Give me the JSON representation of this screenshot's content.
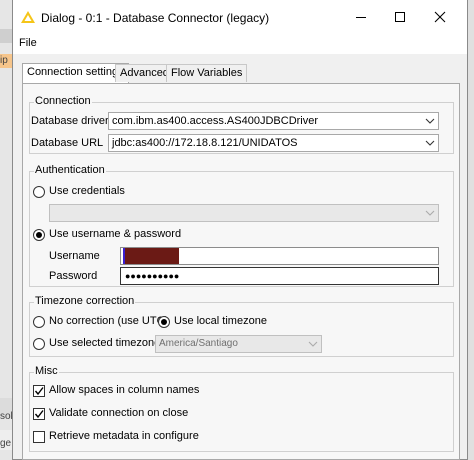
{
  "window": {
    "title": "Dialog - 0:1 - Database Connector (legacy)"
  },
  "menu": {
    "file": "File"
  },
  "tabs": [
    "Connection settings",
    "Advanced",
    "Flow Variables"
  ],
  "connection": {
    "title": "Connection",
    "driver_label": "Database driver",
    "driver_value": "com.ibm.as400.access.AS400JDBCDriver",
    "url_label": "Database URL",
    "url_value": "jdbc:as400://172.18.8.121/UNIDATOS"
  },
  "authentication": {
    "title": "Authentication",
    "use_credentials": "Use credentials",
    "credentials_value": "",
    "use_username_password": "Use username & password",
    "selected": "use_username_password",
    "username_label": "Username",
    "username_value": "",
    "password_label": "Password",
    "password_value": "●●●●●●●●●●"
  },
  "timezone": {
    "title": "Timezone correction",
    "no_correction": "No correction (use UTC)",
    "use_local": "Use local timezone",
    "use_selected": "Use selected timezone",
    "selected_timezone": "America/Santiago",
    "selected": "use_local"
  },
  "misc": {
    "title": "Misc",
    "allow_spaces": "Allow spaces in column names",
    "allow_spaces_checked": true,
    "validate_connection": "Validate connection on close",
    "validate_connection_checked": true,
    "retrieve_metadata": "Retrieve metadata in configure",
    "retrieve_metadata_checked": false
  },
  "background": {
    "left_text_1": "ip",
    "left_text_2": "sol",
    "left_text_3": "ge"
  },
  "colors": {
    "accent_icon": "#f5c518",
    "redaction": "#6b1a15"
  }
}
